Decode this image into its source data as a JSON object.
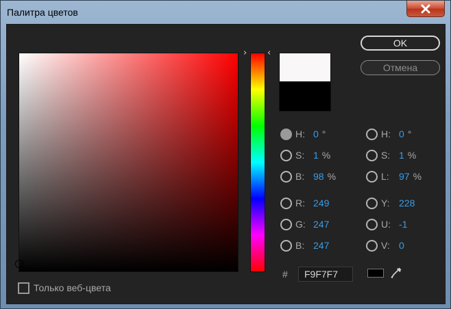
{
  "window": {
    "title": "Палитра цветов",
    "close_icon": "close-icon"
  },
  "buttons": {
    "ok_label": "OK",
    "cancel_label": "Отмена"
  },
  "color": {
    "new_swatch": "#f9f7f7",
    "old_swatch": "#000000",
    "base_hue_color": "#ff0000",
    "hex_hash": "#",
    "hex_value": "F9F7F7"
  },
  "hsb": {
    "h": {
      "label": "H:",
      "value": "0",
      "unit": "°",
      "selected": true
    },
    "s": {
      "label": "S:",
      "value": "1",
      "unit": "%",
      "selected": false
    },
    "b": {
      "label": "B:",
      "value": "98",
      "unit": "%",
      "selected": false
    }
  },
  "rgb": {
    "r": {
      "label": "R:",
      "value": "249",
      "selected": false
    },
    "g": {
      "label": "G:",
      "value": "247",
      "selected": false
    },
    "b": {
      "label": "B:",
      "value": "247",
      "selected": false
    }
  },
  "hsl": {
    "h": {
      "label": "H:",
      "value": "0",
      "unit": "°",
      "selected": false
    },
    "s": {
      "label": "S:",
      "value": "1",
      "unit": "%",
      "selected": false
    },
    "l": {
      "label": "L:",
      "value": "97",
      "unit": "%",
      "selected": false
    }
  },
  "yuv": {
    "y": {
      "label": "Y:",
      "value": "228",
      "selected": false
    },
    "u": {
      "label": "U:",
      "value": "-1",
      "selected": false
    },
    "v": {
      "label": "V:",
      "value": "0",
      "selected": false
    }
  },
  "web_colors": {
    "label": "Только веб-цвета",
    "checked": false
  },
  "icons": {
    "hue_left_arrow": "›",
    "hue_right_arrow": "‹",
    "eyedropper": "eyedropper-icon"
  }
}
